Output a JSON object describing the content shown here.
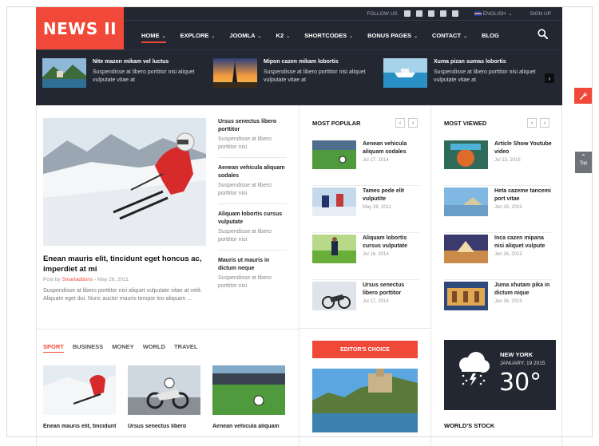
{
  "logo": "NEWS II",
  "topbar": {
    "follow": "FOLLOW US",
    "language": "ENGLISH",
    "signup": "SIGN UP"
  },
  "nav": [
    {
      "label": "HOME",
      "caret": true
    },
    {
      "label": "EXPLORE",
      "caret": true
    },
    {
      "label": "JOOMLA",
      "caret": true
    },
    {
      "label": "K2",
      "caret": true
    },
    {
      "label": "SHORTCODES",
      "caret": true
    },
    {
      "label": "BONUS PAGES",
      "caret": true
    },
    {
      "label": "CONTACT",
      "caret": true
    },
    {
      "label": "BLOG",
      "caret": false
    }
  ],
  "slider": [
    {
      "title": "Nite mazen mikam vel luctus",
      "desc": "Suspendisse at libero porttitor nisi aliquet vulputate vitae at"
    },
    {
      "title": "Mipon cazen mikam lobortis",
      "desc": "Suspendisse at libero porttitor nisi aliquet vulputate vitae at"
    },
    {
      "title": "Xuma pizan sumas lobortis",
      "desc": "Suspendisse at libero porttitor nisi aliquet vulputate vitae at"
    }
  ],
  "featured": {
    "title": "Enean mauris elit, tincidunt eget honcus ac, imperdiet at mi",
    "meta_prefix": "Post by ",
    "author": "Smartaddons",
    "date": " - May 26, 2011",
    "desc": "Suspendisse at libero porttitor nisi aliquet vulputate vitae at velit. Aliquam eget dui. Nunc auctor mauris tempor leo aliquam ..."
  },
  "side_list": [
    {
      "title": "Ursus senectus libero porttitor",
      "desc": "Suspendisse at libero porttitor nisi"
    },
    {
      "title": "Aenean vehicula aliquam sodales",
      "desc": "Suspendisse at libero porttitor nisi"
    },
    {
      "title": "Aliquam lobortis cursus vulputate",
      "desc": "Suspendisse at libero porttitor nisi"
    },
    {
      "title": "Mauris ut mauris in dictum neque",
      "desc": "Suspendisse at libero porttitor nisi"
    }
  ],
  "categories": [
    "SPORT",
    "BUSINESS",
    "MONEY",
    "WORLD",
    "TRAVEL"
  ],
  "cat_cards": [
    {
      "title": "Enean mauris elit, tincidunt"
    },
    {
      "title": "Ursus senectus libero"
    },
    {
      "title": "Aenean vehicula aliquam"
    }
  ],
  "most_popular": {
    "title": "MOST POPULAR",
    "items": [
      {
        "title": "Aenean vehicula aliquam sodales",
        "date": "Jul 17, 2014"
      },
      {
        "title": "Tames pede elit vulputite",
        "date": "May 26, 2011"
      },
      {
        "title": "Aliquam lobortis cursus vulputate",
        "date": "Jul 16, 2014"
      },
      {
        "title": "Ursus senectus libero porttitor",
        "date": "Jul 17, 2014"
      }
    ]
  },
  "most_viewed": {
    "title": "MOST VIEWED",
    "items": [
      {
        "title": "Article Show Youtube video",
        "date": "Jul 13, 2015"
      },
      {
        "title": "Heta cazeme tancemi port vitae",
        "date": "Jan 26, 2015"
      },
      {
        "title": "Inca cazen mipana nisi aliquet vulpute",
        "date": "Jan 26, 2015"
      },
      {
        "title": "Juma xhutam pika in dictum nique",
        "date": "Jan 26, 2015"
      }
    ]
  },
  "editors_choice": "EDITOR'S CHOICE",
  "weather": {
    "city": "NEW YORK",
    "date": "JANUARY, 19 2015",
    "temp": "30°"
  },
  "stock_title": "WORLD'S STOCK",
  "top_label": "Top",
  "colors": {
    "accent": "#f0493a",
    "dark": "#232731"
  }
}
